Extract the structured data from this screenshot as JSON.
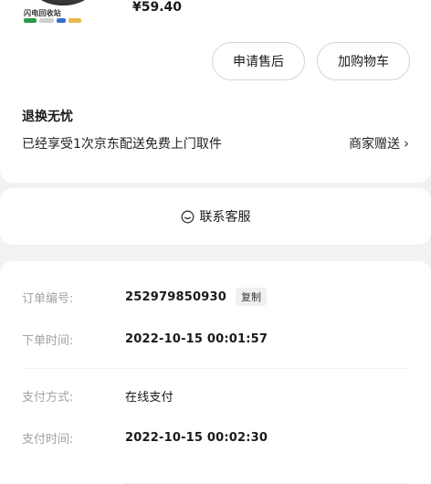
{
  "product": {
    "thumb_brand": "闪电回收站",
    "price": "¥59.40"
  },
  "actions": {
    "after_sale": "申请售后",
    "add_cart": "加购物车"
  },
  "return_policy": {
    "title": "退换无忧",
    "desc": "已经享受1次京东配送免费上门取件",
    "merchant_gift": "商家赠送"
  },
  "contact": {
    "label": "联系客服"
  },
  "order": {
    "number_key": "订单编号:",
    "number_val": "252979850930",
    "copy_label": "复制",
    "created_key": "下单时间:",
    "created_val": "2022-10-15 00:01:57",
    "pay_method_key": "支付方式:",
    "pay_method_val": "在线支付",
    "pay_time_key": "支付时间:",
    "pay_time_val": "2022-10-15 00:02:30"
  },
  "colors": {
    "accent_green": "#2a9a4a",
    "muted_text": "#a3a3a3"
  }
}
